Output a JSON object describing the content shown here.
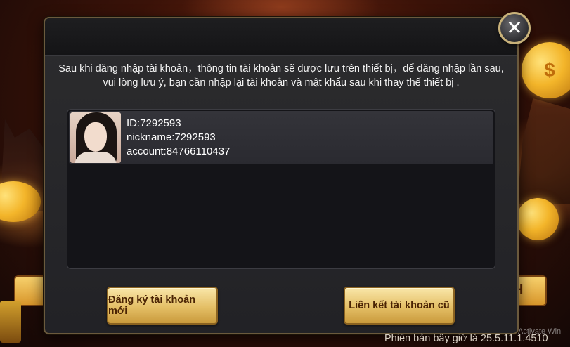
{
  "dialog": {
    "close_symbol": "✕",
    "notice_line1": "Sau khi đăng nhập tài khoản，thông tin tài khoản sẽ được lưu trên thiết bị，để đăng nhập lần sau,",
    "notice_line2": "vui lòng lưu ý, bạn cần nhập lại tài khoản và mật khẩu sau khi thay thế thiết bị ."
  },
  "accounts": [
    {
      "id_text": "ID:7292593",
      "nickname_text": "nickname:7292593",
      "account_text": "account:84766110437"
    }
  ],
  "buttons": {
    "register_label": "Đăng ký tài khoản mới",
    "link_label": "Liên kết tài khoản cũ"
  },
  "background": {
    "coin_symbol": "$",
    "right_button_text": "H"
  },
  "footer": {
    "version_text": "Phiên bản bây giờ là 25.5.11.1.4510",
    "watermark_text": "Activate Win"
  },
  "colors": {
    "dialog_bg": "#2c2c2e",
    "button_gold": "#e4bf66",
    "button_text": "#4a2303",
    "close_border": "#c9b27a"
  }
}
